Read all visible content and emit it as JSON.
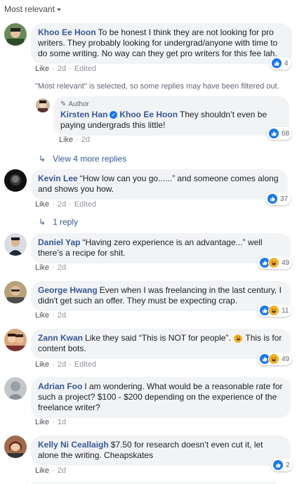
{
  "filter": {
    "label": "Most relevant"
  },
  "note": "\"Most relevant\" is selected, so some replies may have been filtered out.",
  "actions": {
    "like": "Like",
    "edited": "Edited"
  },
  "comments": [
    {
      "name": "Khoo Ee Hoon",
      "text": "To be honest I think they are not looking for pro writers. They probably looking for undergrad/anyone with time to do some writing. No way can they get pro writers for this fee lah.",
      "time": "2d",
      "count": "4",
      "edited": true
    },
    {
      "name": "Kevin Lee",
      "text": "“How low can you go......” and someone comes along and shows you how.",
      "time": "2d",
      "count": "37",
      "edited": true
    },
    {
      "name": "Daniel Yap",
      "text": "“Having zero experience is an advantage...” well there’s a recipe for shit.",
      "time": "2d",
      "count": "49",
      "edited": false
    },
    {
      "name": "George Hwang",
      "text": "Even when I was freelancing in the last century, I didn't get such an offer. They must be expecting crap.",
      "time": "2d",
      "count": "11",
      "edited": false
    },
    {
      "name": "Zann Kwan",
      "text_a": "Like they said “This is NOT for people”.",
      "text_b": "This is for content bots.",
      "time": "2d",
      "count": "49",
      "edited": true
    },
    {
      "name": "Adrian Foo",
      "text": "I am wondering. What would be a reasonable rate for such a project? $100 - $200 depending on the experience of the freelance writer?",
      "time": "1d",
      "count": "",
      "edited": false
    },
    {
      "name": "Kelly Ni Ceallaigh",
      "text": "$7.50 for research doesn’t even cut it, let alone the writing. Cheapskates",
      "time": "2d",
      "count": "2",
      "edited": false
    }
  ],
  "reply": {
    "author_tag": "Author",
    "name": "Kirsten Han",
    "mention": "Khoo Ee Hoon",
    "text": "They shouldn’t even be paying undergrads this little!",
    "time": "2d",
    "count": "68"
  },
  "view_more": "View 4 more replies",
  "one_reply": "1 reply",
  "colors": {
    "link": "#385898",
    "bubble": "#f2f3f5",
    "like": "#1877f2",
    "haha": "#f7b125"
  }
}
